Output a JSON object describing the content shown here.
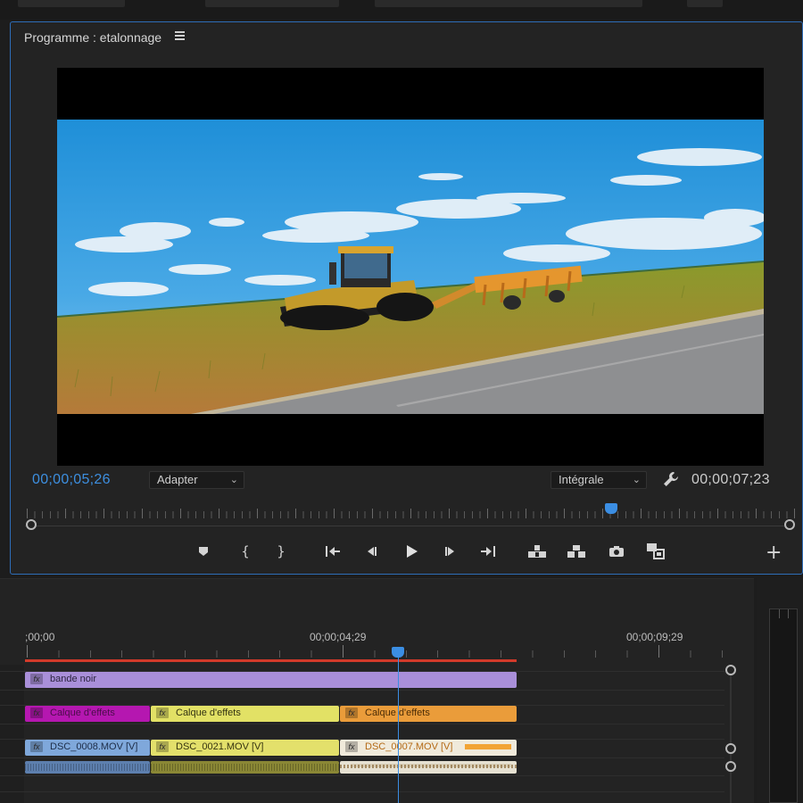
{
  "monitor": {
    "title": "Programme : etalonnage",
    "current_timecode": "00;00;05;26",
    "duration_timecode": "00;00;07;23",
    "fit_select": "Adapter",
    "quality_select": "Intégrale",
    "playhead_position": 0.765
  },
  "transport": [
    {
      "name": "add-marker-button",
      "icon": "marker-icon"
    },
    {
      "name": "mark-in-button",
      "icon": "mark-in-icon"
    },
    {
      "name": "mark-out-button",
      "icon": "mark-out-icon"
    },
    {
      "name": "go-to-in-button",
      "icon": "go-to-in-icon"
    },
    {
      "name": "step-back-button",
      "icon": "step-back-icon"
    },
    {
      "name": "play-button",
      "icon": "play-icon"
    },
    {
      "name": "step-forward-button",
      "icon": "step-forward-icon"
    },
    {
      "name": "go-to-out-button",
      "icon": "go-to-out-icon"
    },
    {
      "name": "lift-button",
      "icon": "lift-icon"
    },
    {
      "name": "extract-button",
      "icon": "extract-icon"
    },
    {
      "name": "export-frame-button",
      "icon": "camera-icon"
    },
    {
      "name": "compare-view-button",
      "icon": "compare-icon"
    }
  ],
  "timeline": {
    "timecodes": [
      ";00;00",
      "00;00;04;29",
      "00;00;09;29"
    ],
    "playhead_position": 0.535,
    "clips": {
      "bande": "bande noir",
      "fx1": "Calque d'effets",
      "fx2": "Calque d'effets",
      "fx3": "Calque d'effets",
      "v1": "DSC_0008.MOV [V]",
      "v2": "DSC_0021.MOV [V]",
      "v3": "DSC_0007.MOV [V]"
    },
    "fx_label": "fx"
  },
  "colors": {
    "accent": "#3b8ee3",
    "work_area": "#d23a2a",
    "clip_bande": "#a98fd9",
    "clip_fx1": "#b517b0",
    "clip_fx2": "#e2e165",
    "clip_fx3": "#ea9c3a"
  }
}
